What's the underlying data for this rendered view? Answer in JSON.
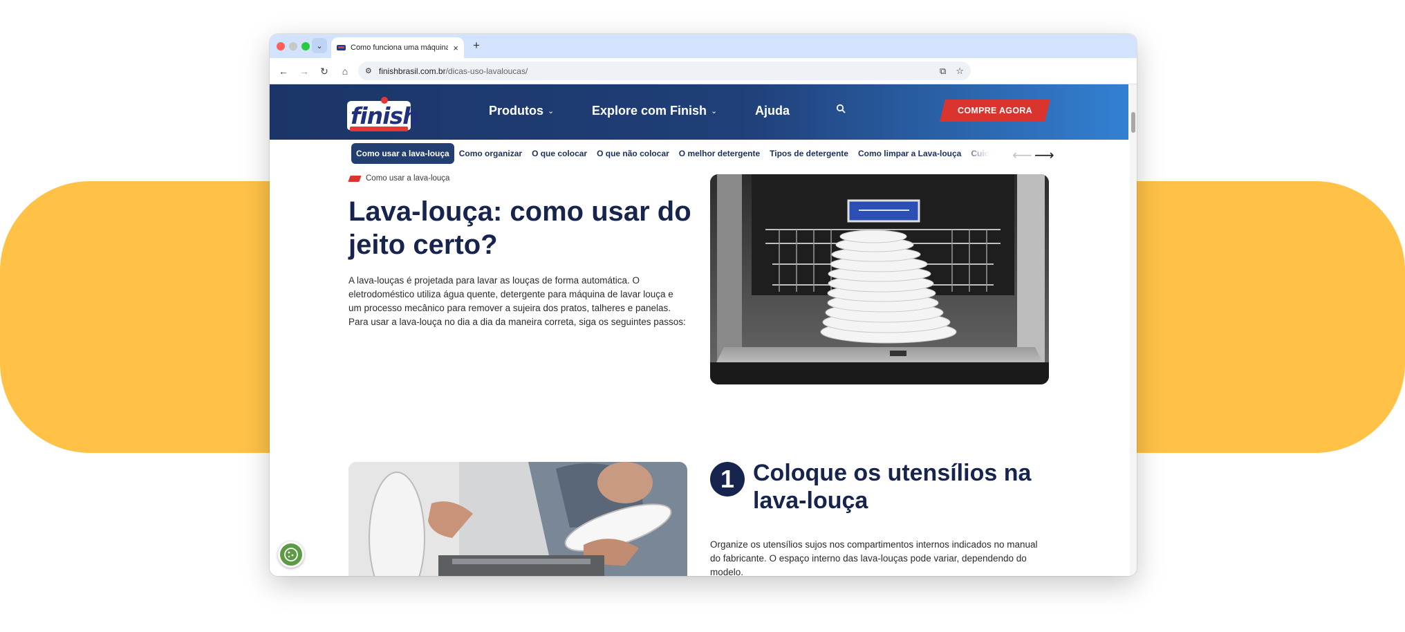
{
  "browser": {
    "tab_title": "Como funciona uma máquina",
    "tab_close": "×",
    "new_tab": "+",
    "url_host": "finishbrasil.com.br",
    "url_path": "/dicas-uso-lavaloucas/"
  },
  "site": {
    "logo_text": "finish",
    "nav": {
      "produtos": "Produtos",
      "explore": "Explore com Finish",
      "ajuda": "Ajuda"
    },
    "cta": "COMPRE AGORA"
  },
  "subnav": {
    "items": [
      "Como usar a lava-louça",
      "Como organizar",
      "O que colocar",
      "O que não colocar",
      "O melhor detergente",
      "Tipos de detergente",
      "Como limpar a Lava-louça",
      "Cuidados e Manutenção"
    ],
    "active_index": 0
  },
  "article": {
    "breadcrumb": "Como usar a lava-louça",
    "title": "Lava-louça: como usar do jeito certo?",
    "intro": "A lava-louças é projetada para lavar as louças de forma automática. O eletrodoméstico utiliza água quente, detergente para máquina de lavar louça e um processo mecânico para remover a sujeira dos pratos, talheres e panelas. Para usar a lava-louça no dia a dia da maneira correta, siga os seguintes passos:",
    "step": {
      "number": "1",
      "title": "Coloque os utensílios na lava-louça",
      "text": "Organize os utensílios sujos nos compartimentos internos indicados no manual do fabricante. O espaço interno das lava-louças pode variar, dependendo do modelo."
    }
  },
  "colors": {
    "navy": "#16244E",
    "header_start": "#1B3567",
    "header_end": "#3380D2",
    "cta_red": "#D9352E",
    "background_band": "#FFC247",
    "cookie_green": "#5C9B43"
  }
}
